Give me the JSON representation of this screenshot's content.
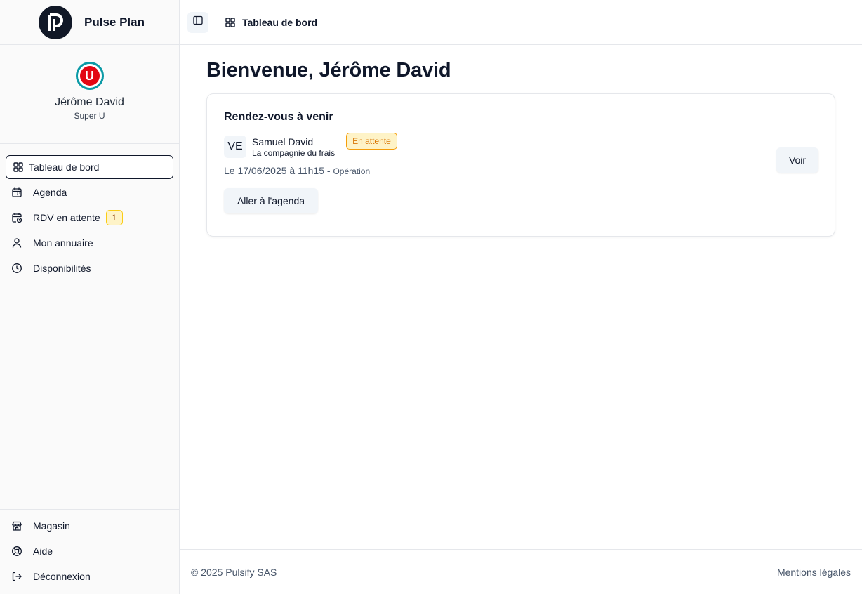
{
  "brand": {
    "name": "Pulse Plan",
    "logo_icon": "pulse-plan-logo-icon"
  },
  "profile": {
    "name": "Jérôme David",
    "organization": "Super U",
    "avatar_letter": "U"
  },
  "sidebar": {
    "items": [
      {
        "label": "Tableau de bord",
        "icon": "dashboard-icon",
        "active": true
      },
      {
        "label": "Agenda",
        "icon": "calendar-icon"
      },
      {
        "label": "RDV en attente",
        "icon": "calendar-clock-icon",
        "badge": "1"
      },
      {
        "label": "Mon annuaire",
        "icon": "user-icon"
      },
      {
        "label": "Disponibilités",
        "icon": "clock-icon"
      }
    ],
    "bottom_items": [
      {
        "label": "Magasin",
        "icon": "store-icon"
      },
      {
        "label": "Aide",
        "icon": "lifebuoy-icon"
      },
      {
        "label": "Déconnexion",
        "icon": "logout-icon"
      }
    ]
  },
  "header": {
    "breadcrumb": "Tableau de bord",
    "toggle_icon": "sidebar-toggle-icon"
  },
  "main": {
    "title": "Bienvenue, Jérôme David",
    "card": {
      "title": "Rendez-vous à venir",
      "appointment": {
        "initials": "VE",
        "name": "Samuel David",
        "company": "La compagnie du frais",
        "status": "En attente",
        "date_text": "Le 17/06/2025 à 11h15",
        "separator": " - ",
        "type": "Opération",
        "view_label": "Voir"
      },
      "agenda_button": "Aller à l'agenda"
    }
  },
  "footer": {
    "copyright": "© 2025 Pulsify SAS",
    "legal_link": "Mentions légales"
  },
  "colors": {
    "primary": "#0f172a",
    "accent_border": "#f59e0b",
    "badge_bg": "#fef3c7",
    "muted": "#475569"
  }
}
